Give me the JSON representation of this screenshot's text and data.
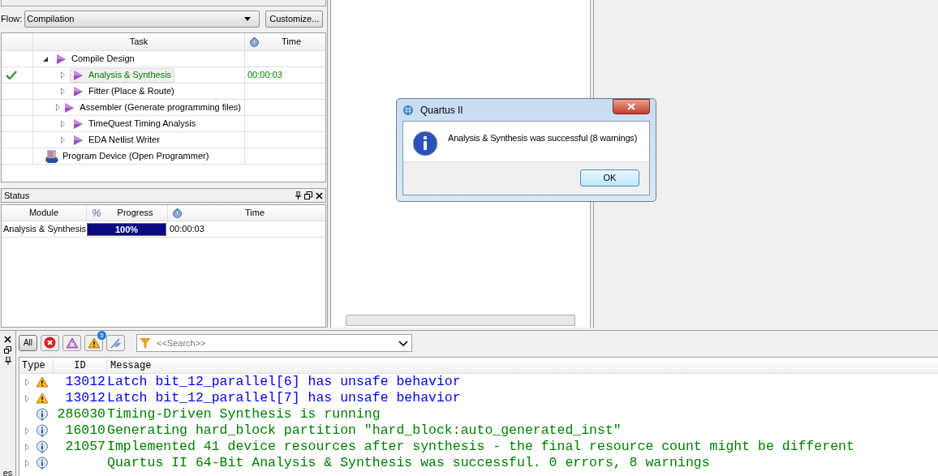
{
  "flow": {
    "label": "Flow:",
    "value": "Compilation",
    "button": "Customize..."
  },
  "task_table": {
    "columns": [
      "Task",
      "Time"
    ],
    "tasks": [
      {
        "label": "Compile Design",
        "kind": "compile",
        "expanded": true,
        "children": [
          {
            "label": "Analysis & Synthesis",
            "kind": "compile",
            "expanded": false,
            "done": true,
            "selected": true,
            "time": "00:00:03"
          },
          {
            "label": "Fitter (Place & Route)",
            "kind": "compile",
            "expanded": false,
            "done": false,
            "selected": false
          },
          {
            "label": "Assembler (Generate programming files)",
            "kind": "compile",
            "expanded": false,
            "done": false,
            "selected": false
          },
          {
            "label": "TimeQuest Timing Analysis",
            "kind": "compile",
            "expanded": false,
            "done": false,
            "selected": false
          },
          {
            "label": "EDA Netlist Writer",
            "kind": "compile",
            "expanded": false,
            "done": false,
            "selected": false
          }
        ]
      },
      {
        "label": "Program Device (Open Programmer)",
        "kind": "programmer"
      }
    ]
  },
  "status_panel": {
    "title": "Status",
    "columns": [
      "Module",
      "%",
      "Progress",
      "Time"
    ],
    "rows": [
      {
        "module": "Analysis & Synthesis",
        "level": 1.0,
        "progress": "100%",
        "time": "00:00:03"
      }
    ]
  },
  "dialog": {
    "title": "Quartus II",
    "message": "Analysis & Synthesis was successful (8 warnings)",
    "button": "OK"
  },
  "messages": {
    "side_label": "es",
    "filter_all": "All",
    "warning_badge": "5",
    "search": {
      "placeholder": "<<Search>>"
    },
    "columns": [
      "Type",
      "ID",
      "Message"
    ],
    "rows": [
      {
        "kind": "warning",
        "expandable": true,
        "id": "13012",
        "text": "Latch bit_12_parallel[6] has unsafe behavior",
        "color": "#0000ff"
      },
      {
        "kind": "warning",
        "expandable": true,
        "id": "13012",
        "text": "Latch bit_12_parallel[7] has unsafe behavior",
        "color": "#0000ff"
      },
      {
        "kind": "info",
        "expandable": false,
        "id": "286030",
        "text": "Timing-Driven Synthesis is running",
        "color": "#008000"
      },
      {
        "kind": "info",
        "expandable": true,
        "id": "16010",
        "text": "Generating hard_block partition \"hard_block:auto_generated_inst\"",
        "color": "#008000"
      },
      {
        "kind": "info",
        "expandable": true,
        "id": "21057",
        "text": "Implemented 41 device resources after synthesis - the final resource count might be different",
        "color": "#008000"
      },
      {
        "kind": "info",
        "expandable": true,
        "text": "Quartus II 64-Bit Analysis & Synthesis was successful. 0 errors, 8 warnings",
        "color": "#008000"
      }
    ]
  }
}
